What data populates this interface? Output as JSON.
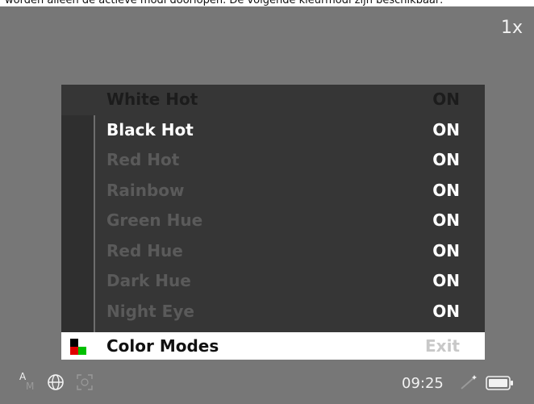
{
  "caption_line": "worden alleen de actieve modi doorlopen. De volgende kleurmodi zijn beschikbaar:",
  "zoom_label": "1x",
  "menu": {
    "items": [
      {
        "label": "White Hot",
        "state": "ON",
        "status": "selected"
      },
      {
        "label": "Black Hot",
        "state": "ON",
        "status": "enabled"
      },
      {
        "label": "Red Hot",
        "state": "ON",
        "status": "disabled"
      },
      {
        "label": "Rainbow",
        "state": "ON",
        "status": "disabled"
      },
      {
        "label": "Green Hue",
        "state": "ON",
        "status": "disabled"
      },
      {
        "label": "Red Hue",
        "state": "ON",
        "status": "disabled"
      },
      {
        "label": "Dark Hue",
        "state": "ON",
        "status": "disabled"
      },
      {
        "label": "Night Eye",
        "state": "ON",
        "status": "disabled"
      }
    ],
    "footer": {
      "label": "Color Modes",
      "action": "Exit",
      "icon": "color-modes-icon"
    }
  },
  "status_bar": {
    "am_top": "A",
    "am_bottom": "M",
    "icons": [
      "globe-icon",
      "face-detect-icon",
      "magic-wand-icon",
      "battery-icon"
    ],
    "time": "09:25"
  },
  "colors": {
    "screen_bg": "#777777",
    "menu_bg": "#363636",
    "highlight": "#ffffff",
    "icon_red": "#e00000",
    "icon_green": "#00c000"
  }
}
